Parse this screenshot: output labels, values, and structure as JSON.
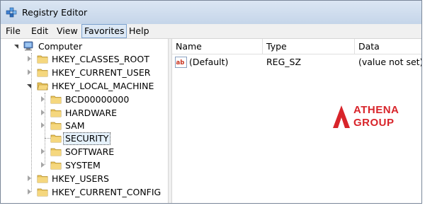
{
  "window": {
    "title": "Registry Editor"
  },
  "menu": [
    "File",
    "Edit",
    "View",
    "Favorites",
    "Help"
  ],
  "tree": {
    "root": "Computer",
    "hives": [
      "HKEY_CLASSES_ROOT",
      "HKEY_CURRENT_USER",
      "HKEY_LOCAL_MACHINE",
      "HKEY_USERS",
      "HKEY_CURRENT_CONFIG"
    ],
    "local_machine_children": [
      "BCD00000000",
      "HARDWARE",
      "SAM",
      "SECURITY",
      "SOFTWARE",
      "SYSTEM"
    ],
    "selected": "SECURITY"
  },
  "list": {
    "columns": [
      "Name",
      "Type",
      "Data"
    ],
    "rows": [
      {
        "icon": "ab",
        "name": "(Default)",
        "type": "REG_SZ",
        "data": "(value not set)"
      }
    ]
  },
  "logo": {
    "line1": "ATHENA",
    "line2": "GROUP"
  },
  "colors": {
    "selection": "#e5f1fb",
    "menu_active": "#dce8f5",
    "logo_red": "#d8242a",
    "folder": "#e8c35a"
  }
}
